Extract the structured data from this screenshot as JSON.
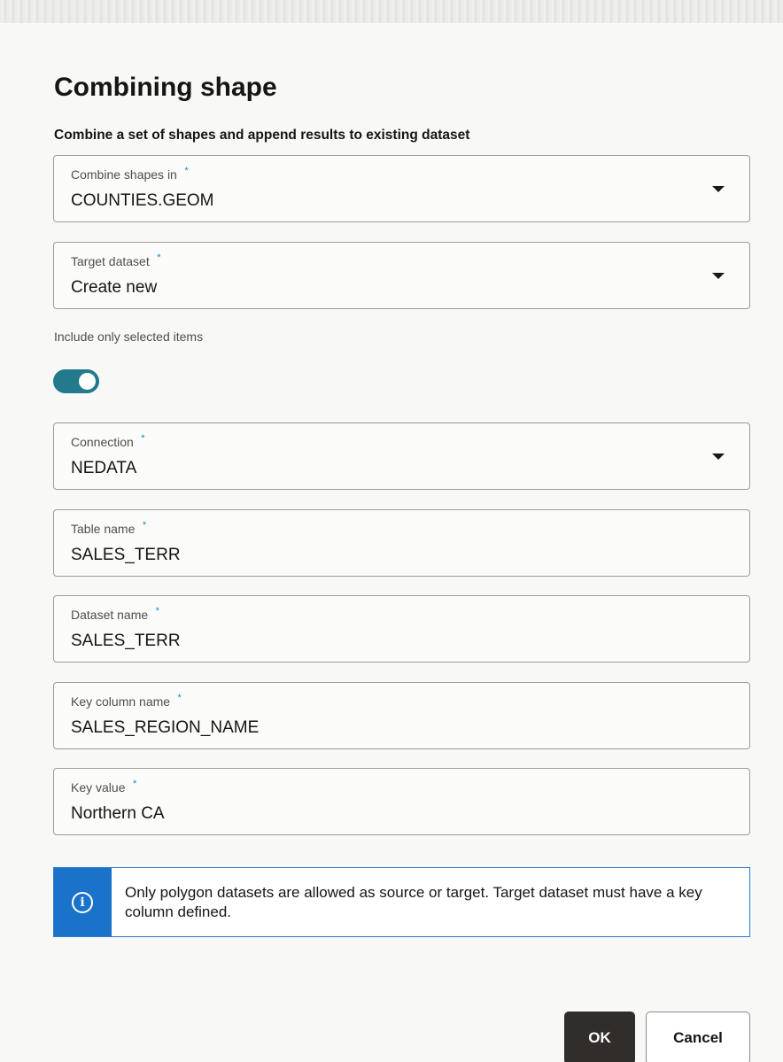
{
  "dialog": {
    "title": "Combining shape",
    "subtitle": "Combine a set of shapes and append results to existing dataset"
  },
  "fields": {
    "combine_shapes_in": {
      "label": "Combine shapes in",
      "value": "COUNTIES.GEOM",
      "type": "select",
      "required": true
    },
    "target_dataset": {
      "label": "Target dataset",
      "value": "Create new",
      "type": "select",
      "required": true
    },
    "connection": {
      "label": "Connection",
      "value": "NEDATA",
      "type": "select",
      "required": true
    },
    "table_name": {
      "label": "Table name",
      "value": "SALES_TERR",
      "type": "text",
      "required": true
    },
    "dataset_name": {
      "label": "Dataset name",
      "value": "SALES_TERR",
      "type": "text",
      "required": true
    },
    "key_column_name": {
      "label": "Key column name",
      "value": "SALES_REGION_NAME",
      "type": "text",
      "required": true
    },
    "key_value": {
      "label": "Key value",
      "value": "Northern CA",
      "type": "text",
      "required": true
    }
  },
  "required_marker": "*",
  "toggle": {
    "label": "Include only selected items",
    "on": true
  },
  "info": {
    "icon": "info-icon",
    "text": "Only polygon datasets are allowed as source or target. Target dataset must have a key column defined."
  },
  "buttons": {
    "ok": "OK",
    "cancel": "Cancel"
  },
  "colors": {
    "toggle_on": "#227a8c",
    "info_accent": "#1b73c9",
    "primary_button": "#312d2a",
    "required_marker": "#1b8ab2"
  }
}
